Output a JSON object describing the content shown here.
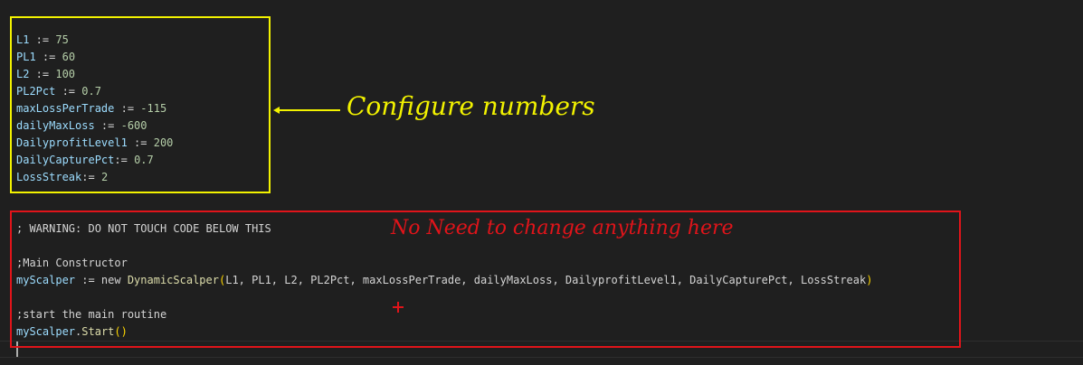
{
  "config": {
    "lines": [
      {
        "name": "L1",
        "op": " := ",
        "value": "75"
      },
      {
        "name": "PL1",
        "op": " := ",
        "value": "60"
      },
      {
        "name": "L2",
        "op": " := ",
        "value": "100"
      },
      {
        "name": "PL2Pct",
        "op": " := ",
        "value": "0.7"
      },
      {
        "name": "maxLossPerTrade",
        "op": " := ",
        "value": "-115"
      },
      {
        "name": "dailyMaxLoss",
        "op": " := ",
        "value": "-600"
      },
      {
        "name": "DailyprofitLevel1",
        "op": " := ",
        "value": "200"
      },
      {
        "name": "DailyCapturePct",
        "op": ":= ",
        "value": "0.7"
      },
      {
        "name": "LossStreak",
        "op": ":= ",
        "value": "2"
      }
    ]
  },
  "code": {
    "warning": "; WARNING: DO NOT TOUCH CODE BELOW THIS",
    "comment_constructor": ";Main Constructor",
    "ctor_var": "myScalper",
    "ctor_assign": " := new ",
    "ctor_class": "DynamicScalper",
    "ctor_open": "(",
    "ctor_args": "L1, PL1, L2, PL2Pct, maxLossPerTrade, dailyMaxLoss, DailyprofitLevel1, DailyCapturePct, LossStreak",
    "ctor_close": ")",
    "comment_start": ";start the main routine",
    "start_var": "myScalper",
    "start_dot": ".",
    "start_method": "Start",
    "start_parens": "()"
  },
  "annotations": {
    "config_label": "Configure numbers",
    "code_label": "No Need to change anything here"
  },
  "colors": {
    "background": "#1f1f1f",
    "config_box": "#f2f200",
    "code_box": "#e0141a",
    "variable": "#9cdcfe",
    "number": "#b5cea8",
    "function": "#dcdcaa",
    "bracket": "#ffd700"
  }
}
